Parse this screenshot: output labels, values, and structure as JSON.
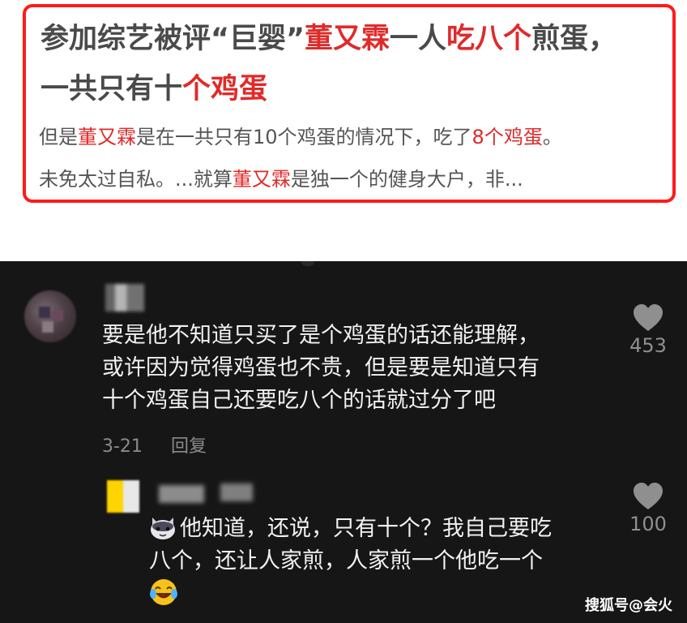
{
  "news": {
    "headline_line1_a": "参加综艺被评“巨婴”",
    "headline_line1_b": "董又霖",
    "headline_line1_c": "一人",
    "headline_line1_d": "吃八个",
    "headline_line1_e": "煎蛋，",
    "headline_line2_a": "一共只有十",
    "headline_line2_b": "个鸡蛋",
    "summary_line1_a": "但是",
    "summary_line1_b": "董又霖",
    "summary_line1_c": "是在一共只有10个鸡蛋的情况下，吃了",
    "summary_line1_d": "8个鸡蛋",
    "summary_line1_e": "。",
    "summary_line2_a": "未免太过自私。...就算",
    "summary_line2_b": "董又霖",
    "summary_line2_c": "是独一个的健身大户，非..."
  },
  "comment": {
    "avatar_icon": "blurred-avatar",
    "lines": [
      "要是他不知道只买了是个鸡蛋的话还能理解，",
      "或许因为觉得鸡蛋也不贵，但是要是知道只有",
      "十个鸡蛋自己还要吃八个的话就过分了吧"
    ],
    "date": "3-21",
    "reply_label": "回复",
    "like_icon": "heart-icon",
    "like_count": "453"
  },
  "reply": {
    "emoji_start": "cat-face-emoji",
    "line1": "他知道，还说，只有十个？我自己要吃",
    "line2": "八个，还让人家煎，人家煎一个他吃一个",
    "emoji_end": "laughing-tears-emoji",
    "like_icon": "heart-icon",
    "like_count": "100"
  },
  "watermark": "搜狐号@会火",
  "colors": {
    "highlight_red": "#e02a2a",
    "card_border": "#ff1a1a",
    "dark_bg": "#161616"
  }
}
